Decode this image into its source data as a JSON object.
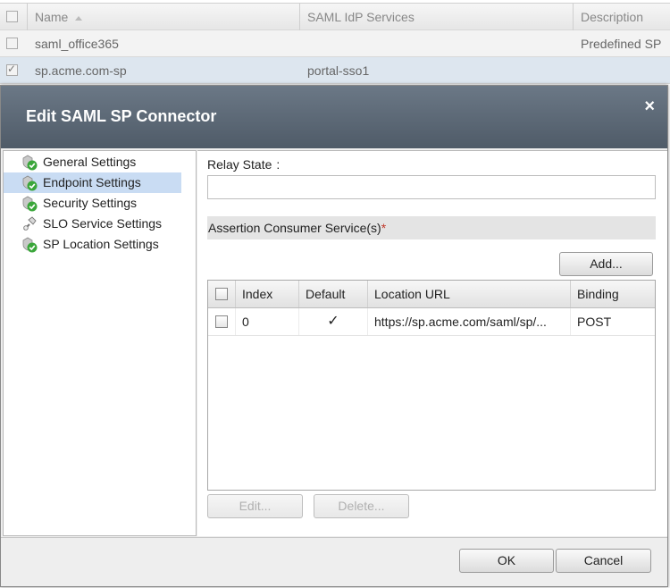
{
  "background_grid": {
    "columns": [
      "Name",
      "SAML IdP Services",
      "Description"
    ],
    "rows": [
      {
        "name": "saml_office365",
        "idp": "",
        "desc": "Predefined SP"
      },
      {
        "name": "sp.acme.com-sp",
        "idp": "portal-sso1",
        "desc": ""
      }
    ]
  },
  "dialog": {
    "title": "Edit SAML SP Connector",
    "close_label": "×",
    "nav": [
      {
        "label": "General Settings",
        "icon": "check-shield-icon"
      },
      {
        "label": "Endpoint Settings",
        "icon": "check-shield-icon",
        "selected": true
      },
      {
        "label": "Security Settings",
        "icon": "check-shield-icon"
      },
      {
        "label": "SLO Service Settings",
        "icon": "link-icon"
      },
      {
        "label": "SP Location Settings",
        "icon": "check-shield-icon"
      }
    ],
    "relay_state_label": "Relay State",
    "relay_state_colon": ":",
    "relay_state_value": "",
    "acs_section_label": "Assertion Consumer Service(s)",
    "required_mark": "*",
    "add_button": "Add...",
    "table": {
      "headers": [
        "Index",
        "Default",
        "Location URL",
        "Binding"
      ],
      "rows": [
        {
          "index": "0",
          "default": "✓",
          "url": "https://sp.acme.com/saml/sp/...",
          "binding": "POST"
        }
      ]
    },
    "edit_button": "Edit...",
    "delete_button": "Delete...",
    "ok_button": "OK",
    "cancel_button": "Cancel"
  },
  "colors": {
    "title_bar": "#5d6977",
    "selection": "#c9dcf3",
    "required": "#c0392b"
  }
}
